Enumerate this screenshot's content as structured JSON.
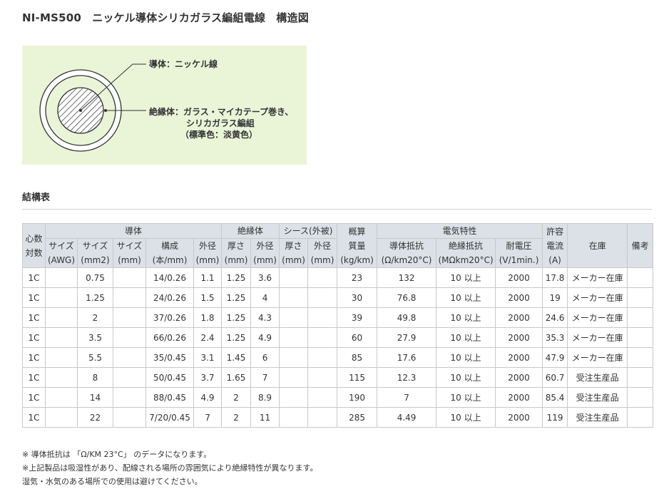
{
  "title": "NI-MS500　ニッケル導体シリカガラス編組電線　構造図",
  "diagram": {
    "conductor_label": "導体：ニッケル線",
    "insulation_line1": "絶縁体：ガラス・マイカテープ巻き、",
    "insulation_line2": "シリカガラス編組",
    "insulation_line3": "（標準色：淡黄色）",
    "colors": {
      "background": "#eaf5d8",
      "ring": "#ffffff",
      "outline": "#333333"
    }
  },
  "section": {
    "title": "結構表"
  },
  "table": {
    "header_bg": "#dbe1e6",
    "groups": {
      "cores": [
        "心数",
        "対数"
      ],
      "conductor": "導体",
      "insulation": "絶縁体",
      "sheath": "シース(外被)",
      "weight": [
        "概算",
        "質量",
        "(kg/km)"
      ],
      "electrical": "電気特性",
      "current": [
        "許容",
        "電流",
        "(A)"
      ],
      "stock": "在庫",
      "remarks": "備考"
    },
    "subheaders": {
      "size_awg": [
        "サイズ",
        "(AWG)"
      ],
      "size_mm2": [
        "サイズ",
        "(mm2)"
      ],
      "size_mm": [
        "サイズ",
        "(mm)"
      ],
      "composition": [
        "構成",
        "(本/mm)"
      ],
      "outer_diameter": [
        "外径",
        "(mm)"
      ],
      "thickness": [
        "厚さ",
        "(mm)"
      ],
      "ins_outer": [
        "外径",
        "(mm)"
      ],
      "sheath_thickness": [
        "厚さ",
        "(mm)"
      ],
      "sheath_outer": [
        "外径",
        "(mm)"
      ],
      "resistance": [
        "導体抵抗",
        "(Ω/km20°C)"
      ],
      "insulation_resistance": [
        "絶縁抵抗",
        "(MΩkm20°C)"
      ],
      "voltage": [
        "耐電圧",
        "(V/1min.)"
      ]
    },
    "rows": [
      [
        "1C",
        "",
        "0.75",
        "",
        "14/0.26",
        "1.1",
        "1.25",
        "3.6",
        "",
        "",
        "23",
        "132",
        "10 以上",
        "2000",
        "17.8",
        "メーカー在庫",
        ""
      ],
      [
        "1C",
        "",
        "1.25",
        "",
        "24/0.26",
        "1.5",
        "1.25",
        "4",
        "",
        "",
        "30",
        "76.8",
        "10 以上",
        "2000",
        "19",
        "メーカー在庫",
        ""
      ],
      [
        "1C",
        "",
        "2",
        "",
        "37/0.26",
        "1.8",
        "1.25",
        "4.3",
        "",
        "",
        "39",
        "49.8",
        "10 以上",
        "2000",
        "24.6",
        "メーカー在庫",
        ""
      ],
      [
        "1C",
        "",
        "3.5",
        "",
        "66/0.26",
        "2.4",
        "1.25",
        "4.9",
        "",
        "",
        "60",
        "27.9",
        "10 以上",
        "2000",
        "35.3",
        "メーカー在庫",
        ""
      ],
      [
        "1C",
        "",
        "5.5",
        "",
        "35/0.45",
        "3.1",
        "1.45",
        "6",
        "",
        "",
        "85",
        "17.6",
        "10 以上",
        "2000",
        "47.9",
        "メーカー在庫",
        ""
      ],
      [
        "1C",
        "",
        "8",
        "",
        "50/0.45",
        "3.7",
        "1.65",
        "7",
        "",
        "",
        "115",
        "12.3",
        "10 以上",
        "2000",
        "60.7",
        "受注生産品",
        ""
      ],
      [
        "1C",
        "",
        "14",
        "",
        "88/0.45",
        "4.9",
        "2",
        "8.9",
        "",
        "",
        "190",
        "7",
        "10 以上",
        "2000",
        "85.4",
        "受注生産品",
        ""
      ],
      [
        "1C",
        "",
        "22",
        "",
        "7/20/0.45",
        "7",
        "2",
        "11",
        "",
        "",
        "285",
        "4.49",
        "10 以上",
        "2000",
        "119",
        "受注生産品",
        ""
      ]
    ]
  },
  "notes": [
    "※ 導体抵抗は 「Ω/KM 23°C」 のデータになります。",
    "※上記製品は吸湿性があり、配線される場所の雰囲気により絶縁特性が異なります。",
    "湿気・水気のある場所での使用は避けてください。"
  ]
}
